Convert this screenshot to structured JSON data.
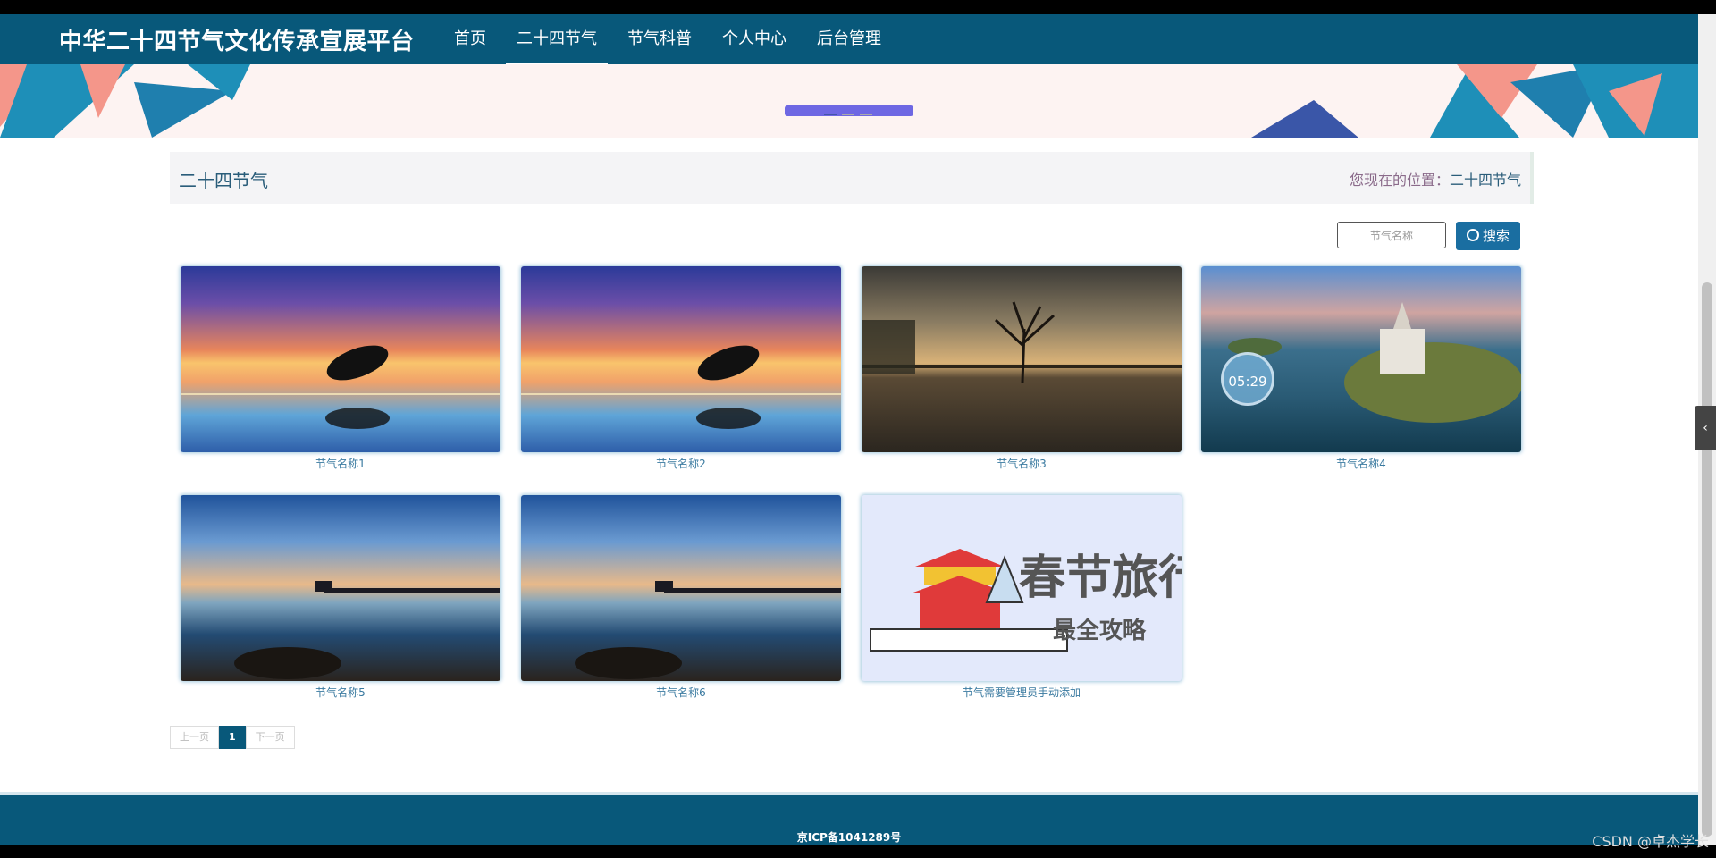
{
  "brand": "中华二十四节气文化传承宣展平台",
  "nav": [
    {
      "label": "首页"
    },
    {
      "label": "二十四节气",
      "active": true
    },
    {
      "label": "节气科普"
    },
    {
      "label": "个人中心"
    },
    {
      "label": "后台管理"
    }
  ],
  "breadcrumb": {
    "title": "二十四节气",
    "position_label": "您现在的位置：",
    "position_current": "二十四节气"
  },
  "search": {
    "placeholder": "节气名称",
    "button_label": "搜索"
  },
  "cards": [
    {
      "label": "节气名称1"
    },
    {
      "label": "节气名称2"
    },
    {
      "label": "节气名称3"
    },
    {
      "label": "节气名称4",
      "timer": "05:29"
    },
    {
      "label": "节气名称5"
    },
    {
      "label": "节气名称6"
    },
    {
      "label": "节气需要管理员手动添加",
      "image_text_1": "春节旅行",
      "image_text_2": "最全攻略"
    }
  ],
  "pager": {
    "prev": "上一页",
    "current": "1",
    "next": "下一页"
  },
  "footer": {
    "icp": "京ICP备1041289号"
  },
  "watermark": "CSDN @卓杰学长",
  "colors": {
    "primary": "#08587a",
    "button": "#1a6ea1",
    "banner_bg": "#fdf3f2"
  }
}
